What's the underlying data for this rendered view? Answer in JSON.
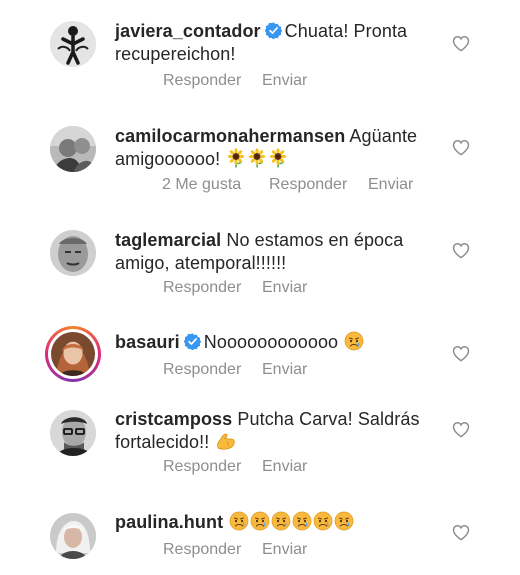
{
  "comments": [
    {
      "username": "javiera_contador",
      "verified": true,
      "text": "Chuata! Pronta recupereichon!",
      "likes": "",
      "reply_label": "Responder",
      "send_label": "Enviar"
    },
    {
      "username": "camilocarmonahermansen",
      "verified": false,
      "text": "Agüante amigoooooo!",
      "emojis": [
        "sunflower-emoji",
        "sunflower-emoji",
        "sunflower-emoji"
      ],
      "likes": "2 Me gusta",
      "reply_label": "Responder",
      "send_label": "Enviar"
    },
    {
      "username": "taglemarcial",
      "verified": false,
      "text": "No estamos en época amigo, atemporal!!!!!!",
      "likes": "",
      "reply_label": "Responder",
      "send_label": "Enviar"
    },
    {
      "username": "basauri",
      "verified": true,
      "text": "Noooooooooooo",
      "emojis": [
        "sad-face-emoji"
      ],
      "likes": "",
      "reply_label": "Responder",
      "send_label": "Enviar"
    },
    {
      "username": "cristcamposs",
      "verified": false,
      "text": "Putcha Carva! Saldrás fortalecido!!",
      "emojis": [
        "flexed-biceps-emoji"
      ],
      "likes": "",
      "reply_label": "Responder",
      "send_label": "Enviar"
    },
    {
      "username": "paulina.hunt",
      "verified": false,
      "text": "",
      "emojis": [
        "sad-face-emoji",
        "sad-face-emoji",
        "sad-face-emoji",
        "sad-face-emoji",
        "sad-face-emoji",
        "sad-face-emoji"
      ],
      "likes": "",
      "reply_label": "Responder",
      "send_label": "Enviar"
    }
  ],
  "colors": {
    "text": "#262626",
    "secondary": "#8e8e8e",
    "verified_blue": "#3897f0",
    "story_ring": "#dd2a7b"
  }
}
